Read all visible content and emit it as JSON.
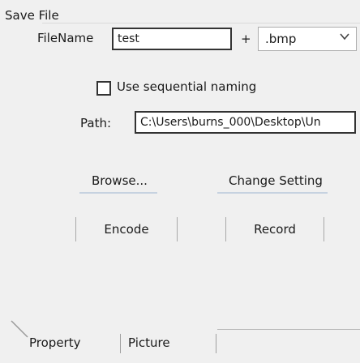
{
  "group": {
    "title": "Save File"
  },
  "file": {
    "label": "FileName",
    "name_value": "test",
    "plus": "+",
    "extension": ".bmp"
  },
  "sequential": {
    "label": "Use sequential naming",
    "checked": false
  },
  "path": {
    "label": "Path:",
    "value": "C:\\Users\\burns_000\\Desktop\\Un"
  },
  "actions": {
    "browse_label": "Browse...",
    "change_setting_label": "Change Setting"
  },
  "buttons": {
    "encode_label": "Encode",
    "record_label": "Record"
  },
  "tabs": [
    {
      "label": "Property"
    },
    {
      "label": "Picture"
    }
  ],
  "colors": {
    "accent_underline": "#c6d2e0",
    "background": "#f0f0f0"
  }
}
